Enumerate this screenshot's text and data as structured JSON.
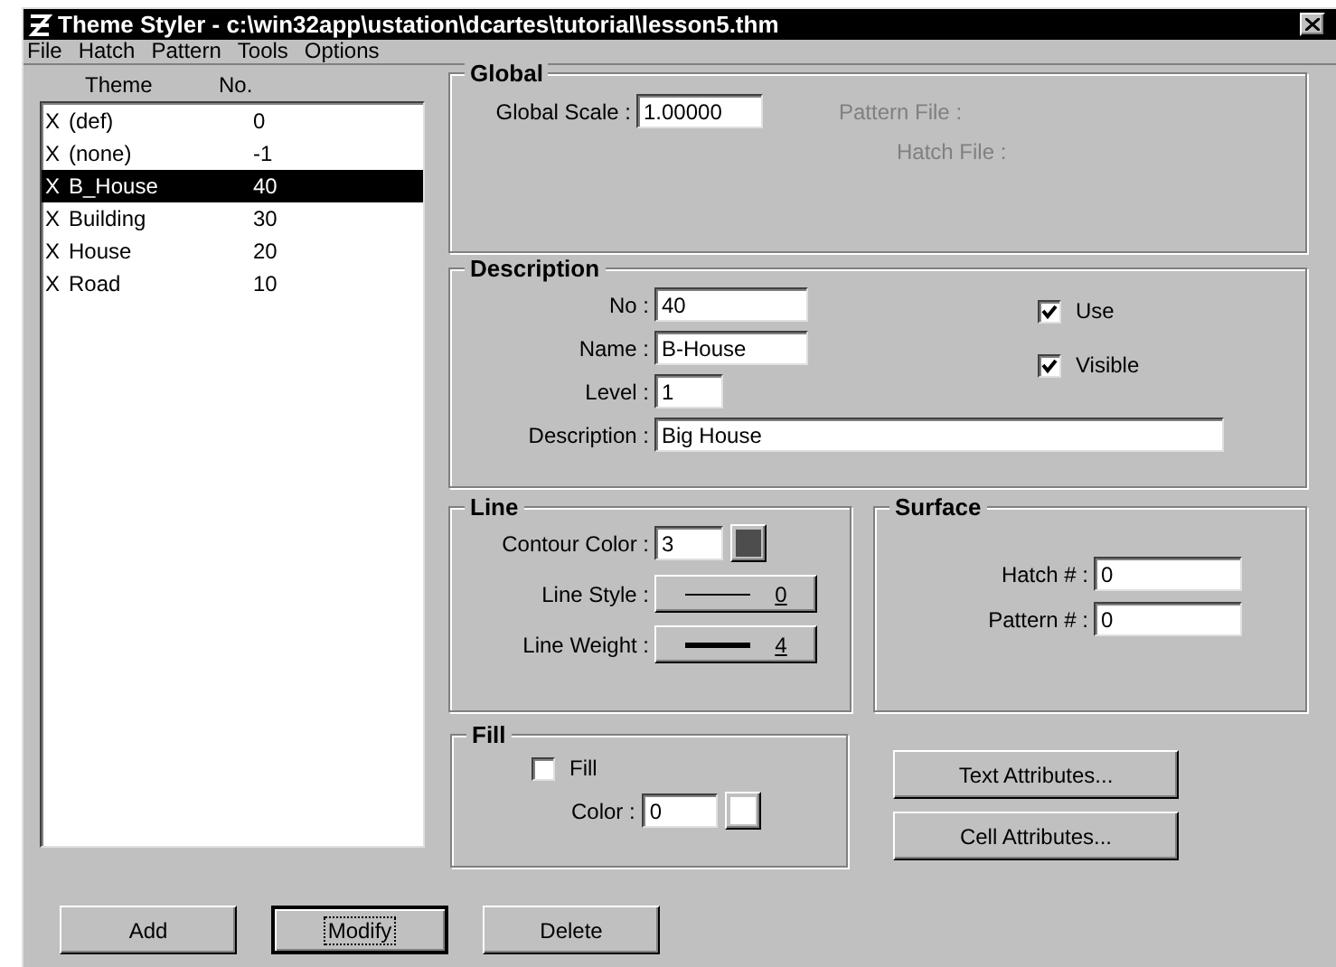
{
  "window": {
    "title": "Theme Styler - c:\\win32app\\ustation\\dcartes\\tutorial\\lesson5.thm"
  },
  "menu": [
    "File",
    "Hatch",
    "Pattern",
    "Tools",
    "Options"
  ],
  "themes": {
    "columns": [
      "Theme",
      "No."
    ],
    "rows": [
      {
        "mark": "X",
        "name": "(def)",
        "no": "0",
        "selected": false
      },
      {
        "mark": "X",
        "name": "(none)",
        "no": "-1",
        "selected": false
      },
      {
        "mark": "X",
        "name": "B_House",
        "no": "40",
        "selected": true
      },
      {
        "mark": "X",
        "name": "Building",
        "no": "30",
        "selected": false
      },
      {
        "mark": "X",
        "name": "House",
        "no": "20",
        "selected": false
      },
      {
        "mark": "X",
        "name": "Road",
        "no": "10",
        "selected": false
      }
    ]
  },
  "global": {
    "title": "Global",
    "scale_label": "Global Scale :",
    "scale": "1.00000",
    "pattern_file": {
      "label": "Pattern File :",
      "disabled": true
    },
    "hatch_file": {
      "label": "Hatch File :",
      "disabled": true
    }
  },
  "description": {
    "title": "Description",
    "fields": [
      {
        "label": "No :",
        "value": "40",
        "kind": "short"
      },
      {
        "label": "Name :",
        "value": "B-House",
        "kind": "short"
      },
      {
        "label": "Level :",
        "value": "1",
        "kind": "tiny"
      },
      {
        "label": "Description :",
        "value": "Big House",
        "kind": "long"
      }
    ],
    "checks": [
      {
        "label": "Use",
        "checked": true
      },
      {
        "label": "Visible",
        "checked": true
      }
    ]
  },
  "line": {
    "title": "Line",
    "contour": {
      "label": "Contour Color :",
      "value": "3",
      "color": "#4d4d4d"
    },
    "styles": [
      {
        "label": "Line Style :",
        "value": "0",
        "kind": "style"
      },
      {
        "label": "Line Weight :",
        "value": "4",
        "kind": "weight"
      }
    ]
  },
  "surface": {
    "title": "Surface",
    "fields": [
      {
        "label": "Hatch # :",
        "value": "0"
      },
      {
        "label": "Pattern # :",
        "value": "0"
      }
    ]
  },
  "fill": {
    "title": "Fill",
    "check": {
      "label": "Fill",
      "checked": false
    },
    "color": {
      "label": "Color :",
      "value": "0",
      "color": "#ffffff"
    }
  },
  "side_buttons": [
    "Text Attributes...",
    "Cell Attributes..."
  ],
  "buttons": [
    {
      "label": "Add",
      "focused": false
    },
    {
      "label": "Modify",
      "focused": true
    },
    {
      "label": "Delete",
      "focused": false
    }
  ]
}
